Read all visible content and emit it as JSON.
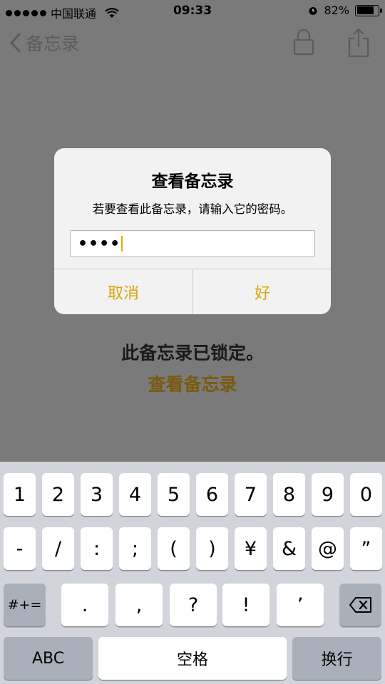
{
  "status_bar": {
    "carrier": "中国联通",
    "time": "09:33",
    "battery": "82%",
    "battery_level": 0.82
  },
  "nav": {
    "back_label": "备忘录"
  },
  "alert": {
    "title": "查看备忘录",
    "message": "若要查看此备忘录，请输入它的密码。",
    "password_value": "••••",
    "cancel_label": "取消",
    "ok_label": "好"
  },
  "background": {
    "locked_message": "此备忘录已锁定。",
    "view_note_link": "查看备忘录"
  },
  "keyboard": {
    "row1": [
      "1",
      "2",
      "3",
      "4",
      "5",
      "6",
      "7",
      "8",
      "9",
      "0"
    ],
    "row2": [
      "-",
      "/",
      ":",
      ";",
      "(",
      ")",
      "¥",
      "&",
      "@",
      "”"
    ],
    "row3_shift": "#+=",
    "row3": [
      ".",
      ",",
      "?",
      "!",
      "’"
    ],
    "row4_abc": "ABC",
    "row4_space": "空格",
    "row4_return": "换行"
  },
  "colors": {
    "accent": "#dba60b",
    "dimmed_link": "#7a5a0c"
  }
}
